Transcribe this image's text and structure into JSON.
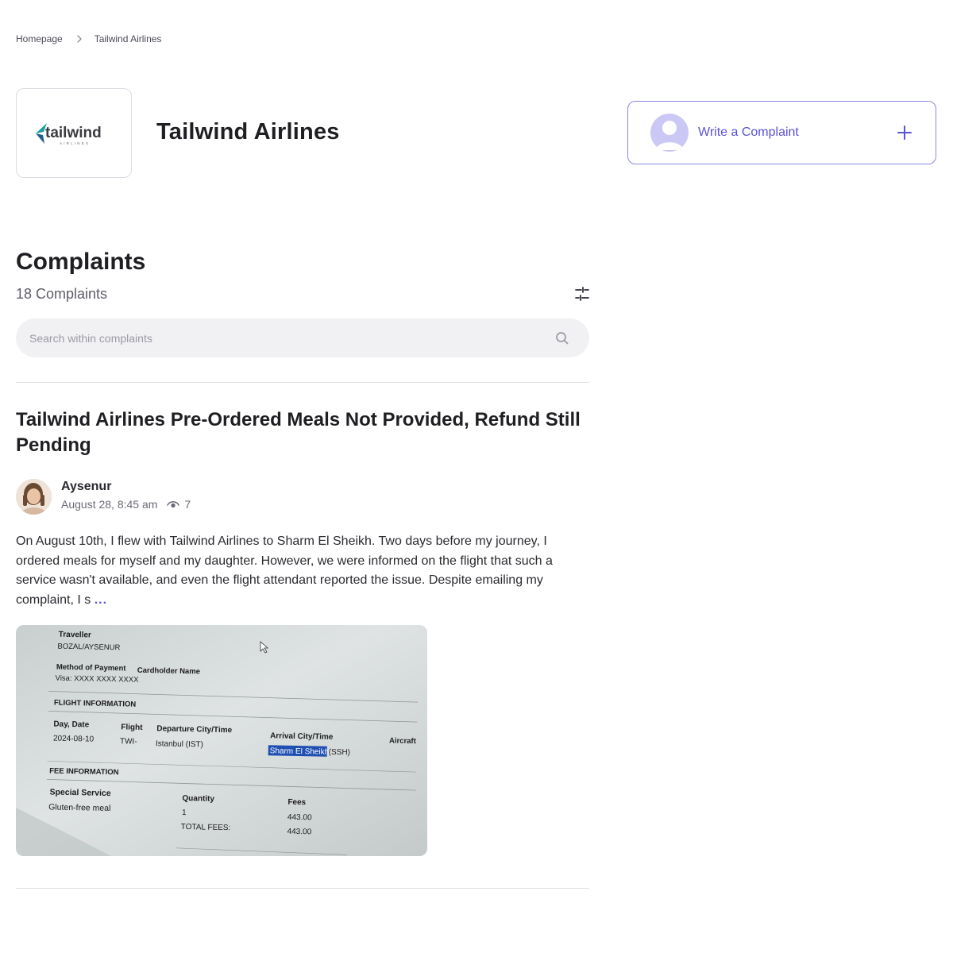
{
  "breadcrumb": {
    "home": "Homepage",
    "current": "Tailwind Airlines"
  },
  "brand": {
    "name": "Tailwind Airlines",
    "logo_word": "tailwind",
    "logo_sub": "AIRLINES",
    "accent_color": "#5b52d6"
  },
  "write_complaint": {
    "label": "Write a Complaint"
  },
  "complaints": {
    "heading": "Complaints",
    "count_label": "18 Complaints",
    "search_placeholder": "Search within complaints"
  },
  "complaint": {
    "title": "Tailwind Airlines Pre-Ordered Meals Not Provided, Refund Still Pending",
    "author": "Aysenur",
    "date": "August 28, 8:45 am",
    "views": "7",
    "body": "On August 10th, I flew with Tailwind Airlines to Sharm El Sheikh. Two days before my journey, I ordered meals for myself and my daughter. However, we were informed on the flight that such a service wasn't available, and even the flight attendant reported the issue. Despite emailing my complaint, I s",
    "more": "...",
    "attachment": {
      "traveller_label": "Traveller",
      "traveller_value": "BOZAL/AYSENUR",
      "payment_label": "Method of Payment",
      "cardholder_label": "Cardholder Name",
      "payment_value": "Visa: XXXX XXXX XXXX",
      "flight_info_label": "FLIGHT INFORMATION",
      "day_date_label": "Day, Date",
      "day_date_value": "2024-08-10",
      "flight_label": "Flight",
      "flight_value": "TWI-",
      "departure_label": "Departure City/Time",
      "departure_value": "Istanbul (IST)",
      "arrival_label": "Arrival City/Time",
      "arrival_value_highlight": "Sharm El Sheikh",
      "arrival_value_code": "(SSH)",
      "aircraft_label": "Aircraft",
      "fee_info_label": "FEE INFORMATION",
      "special_service_label": "Special Service",
      "special_service_value": "Gluten-free meal",
      "quantity_label": "Quantity",
      "quantity_value": "1",
      "total_fees_label": "TOTAL FEES:",
      "fees_label": "Fees",
      "fees_value": "443.00",
      "total_fees_value": "443.00"
    }
  },
  "icons": {
    "chevron": "chevron-right-icon",
    "plus": "plus-icon",
    "filter": "sliders-icon",
    "search": "search-icon",
    "eye": "eye-icon"
  }
}
